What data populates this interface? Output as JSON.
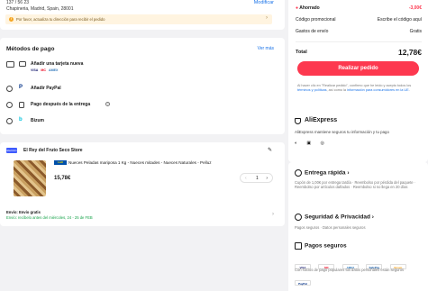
{
  "address": {
    "line1": "137 / 56 23",
    "line2": "Chapineria, Madrid, Spain, 28001",
    "modify_label": "Modificar",
    "warning": "Por favor, actualiza tu dirección para recibir el pedido"
  },
  "payment": {
    "title": "Métodos de pago",
    "more_label": "Ver más",
    "methods": [
      {
        "label": "Añadir una tarjeta nueva",
        "icon": "card-icon"
      },
      {
        "label": "Añadir PayPal",
        "icon": "paypal-icon"
      },
      {
        "label": "Pago después de la entrega",
        "icon": "cash-icon"
      },
      {
        "label": "Bizum",
        "icon": "bizum-icon"
      }
    ],
    "card_brands": [
      "VISA",
      "MC",
      "AMEX"
    ]
  },
  "store": {
    "badge": "Elección",
    "name": "El Rey del Fruto Seco Store",
    "product_brand": "Lidl",
    "product_name": "Nueces Peladas mariposa 1 Kg - Nueces mitades - Nueces Naturales - Pelluz",
    "price": "15,78€",
    "quantity": "1",
    "shipping_line1": "Envío: Envío gratis",
    "shipping_line2": "Envío: recíbelo antes del miércoles, 24 - 25 de FEB"
  },
  "summary": {
    "rows": [
      {
        "key": "Ahorrado",
        "value": "-3,00€"
      },
      {
        "key": "Código promocional",
        "value": "Escribe el código aquí"
      },
      {
        "key": "Gastos de envío",
        "value": "Gratis"
      }
    ],
    "total_label": "Total",
    "total_value": "12,78€",
    "order_button": "Realizar pedido",
    "legal_prefix": "Al hacer clic en \"Realizar pedido\", confirmo que he leído y acepto todos los",
    "legal_link": "términos y políticas",
    "legal_mid": ", así como la",
    "legal_link2": "información para consumidores en la UE",
    "colors": {
      "accent": "#fd384f",
      "saved": "#fd384f",
      "success": "#17a34a",
      "link": "#1a73e8"
    }
  },
  "brand": {
    "name": "AliExpress",
    "text": "AliExpress mantiene seguros tu información y tu pago"
  },
  "features": {
    "delivery_title": "Entrega rápida",
    "delivery_text": "Cupón de 1,00€ por entrega tardía · Reembolso por pérdida del paquete · Reembolso por artículos dañados · Reembolso si no llega en 20 días",
    "security_title": "Seguridad & Privacidad",
    "security_text": "Pagos seguros · Datos personales seguros",
    "pay_title": "Pagos seguros",
    "pay_brands": [
      "VISA",
      "MC",
      "AMEX",
      "SafePay",
      "Bizum",
      "PayPal"
    ],
    "pay_text": "Con socios de pago populares tus datos personales están seguros"
  }
}
